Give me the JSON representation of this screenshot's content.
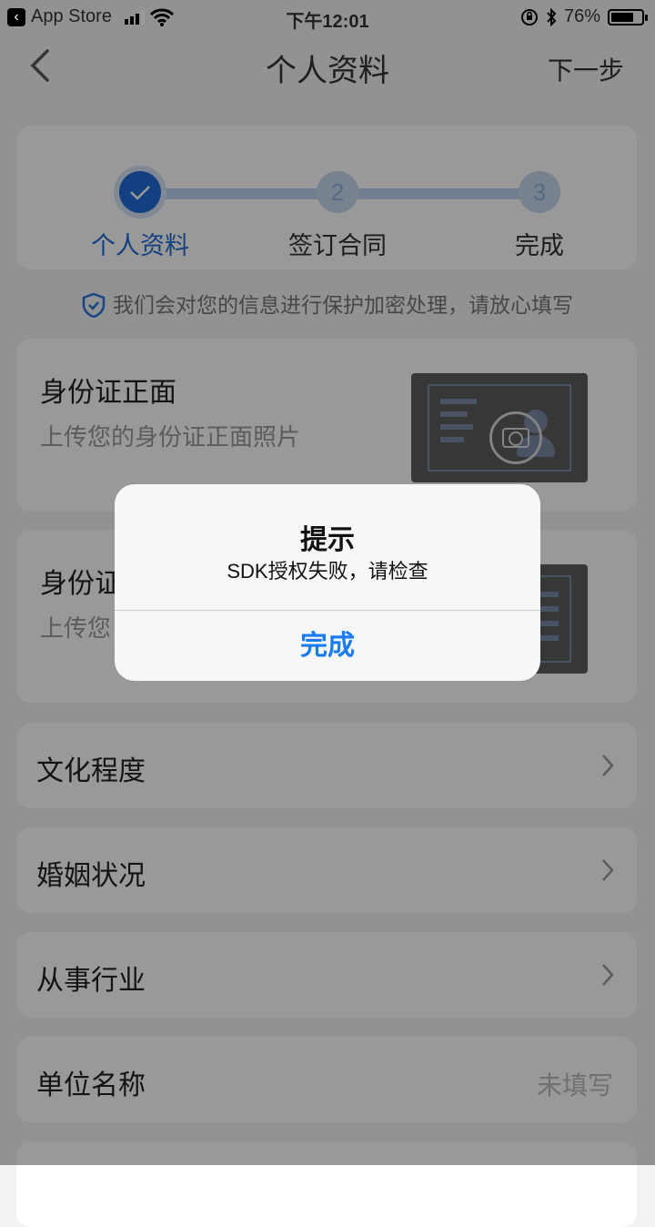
{
  "status_bar": {
    "back_app": "App Store",
    "time": "下午12:01",
    "battery_percent": "76%",
    "battery_level": 0.76
  },
  "nav": {
    "title": "个人资料",
    "next": "下一步",
    "back_icon": "chevron-left-icon"
  },
  "stepper": {
    "steps": [
      {
        "number": "",
        "label": "个人资料",
        "state": "done"
      },
      {
        "number": "2",
        "label": "签订合同",
        "state": "pending"
      },
      {
        "number": "3",
        "label": "完成",
        "state": "pending"
      }
    ],
    "active_color": "#1e6cd6"
  },
  "notice": {
    "text": "我们会对您的信息进行保护加密处理，请放心填写",
    "icon": "shield-check-icon"
  },
  "uploads": [
    {
      "title": "身份证正面",
      "subtitle": "上传您的身份证正面照片"
    },
    {
      "title": "身份证",
      "subtitle": "上传您"
    }
  ],
  "form_rows": [
    {
      "label": "文化程度",
      "value": ""
    },
    {
      "label": "婚姻状况",
      "value": ""
    },
    {
      "label": "从事行业",
      "value": ""
    },
    {
      "label": "单位名称",
      "value": "未填写"
    }
  ],
  "alert": {
    "title": "提示",
    "message": "SDK授权失败，请检查",
    "button": "完成",
    "button_color": "#1a7cf0"
  }
}
